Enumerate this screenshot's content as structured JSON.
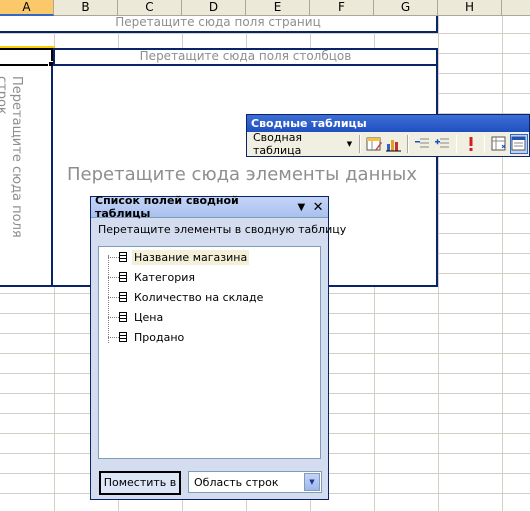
{
  "columns": [
    "A",
    "B",
    "C",
    "D",
    "E",
    "F",
    "G",
    "H"
  ],
  "pivot": {
    "page_fields_placeholder": "Перетащите сюда поля страниц",
    "column_fields_placeholder": "Перетащите сюда поля столбцов",
    "row_fields_placeholder": "Перетащите сюда поля строк",
    "data_items_placeholder": "Перетащите сюда элементы данных"
  },
  "toolbar": {
    "title": "Сводные таблицы",
    "menu_label": "Сводная таблица",
    "buttons": [
      "format-report-icon",
      "chart-wizard-icon",
      "hide-detail-icon",
      "show-detail-icon",
      "refresh-data-icon",
      "include-hidden-icon",
      "field-list-icon"
    ]
  },
  "field_list": {
    "title": "Список полей сводной таблицы",
    "instruction": "Перетащите элементы в сводную таблицу",
    "fields": [
      "Название магазина",
      "Категория",
      "Количество на складе",
      "Цена",
      "Продано"
    ],
    "put_button": "Поместить в",
    "area_selected": "Область строк"
  }
}
